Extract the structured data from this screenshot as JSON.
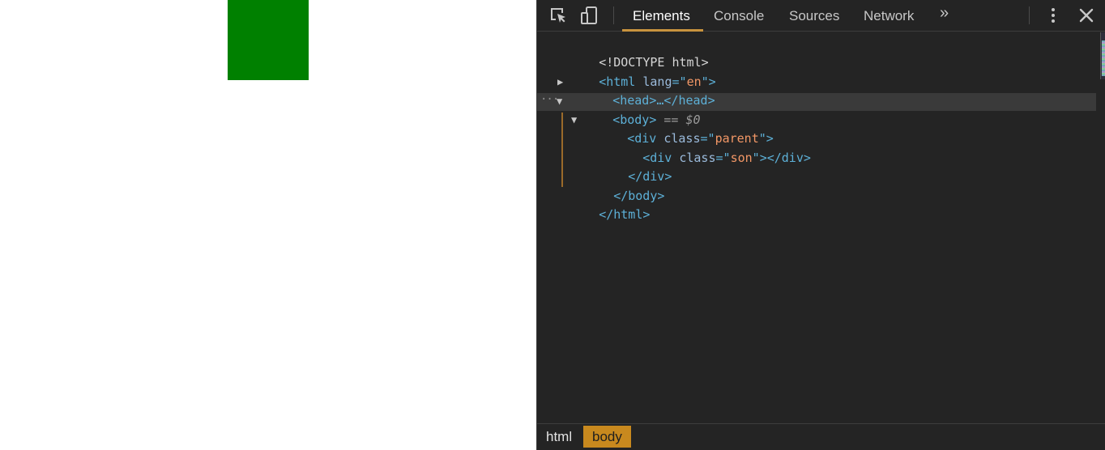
{
  "page": {
    "box_color": "#008000"
  },
  "devtools": {
    "tabs": [
      {
        "label": "Elements",
        "active": true
      },
      {
        "label": "Console"
      },
      {
        "label": "Sources"
      },
      {
        "label": "Network"
      }
    ],
    "icons": [
      "inspect-element-icon",
      "device-toolbar-icon",
      "more-tabs-icon",
      "kebab-menu-icon",
      "close-icon"
    ],
    "more_tabs_glyph": "»",
    "tree": {
      "doctype": "<!DOCTYPE html>",
      "html_open_tag": "<html",
      "html_attr": "lang",
      "html_eq": "=\"",
      "html_attr_value": "en",
      "html_close_quote": "\">",
      "head_collapsed": "<head>…</head>",
      "body_open": "<body>",
      "selected_marker": "== $0",
      "div_parent_open": "<div",
      "div_parent_attr": "class",
      "div_parent_value": "parent",
      "div_son_open": "<div",
      "div_son_attr": "class",
      "div_son_value": "son",
      "div_son_close": "></div>",
      "div_close": "</div>",
      "body_close": "</body>",
      "html_close": "</html>"
    },
    "breadcrumbs": [
      {
        "label": "html"
      },
      {
        "label": "body",
        "active": true
      }
    ],
    "colors": {
      "accent": "#c8933e",
      "panel_bg": "#242424",
      "tag": "#5db0d7",
      "attr_value": "#f29766"
    }
  }
}
